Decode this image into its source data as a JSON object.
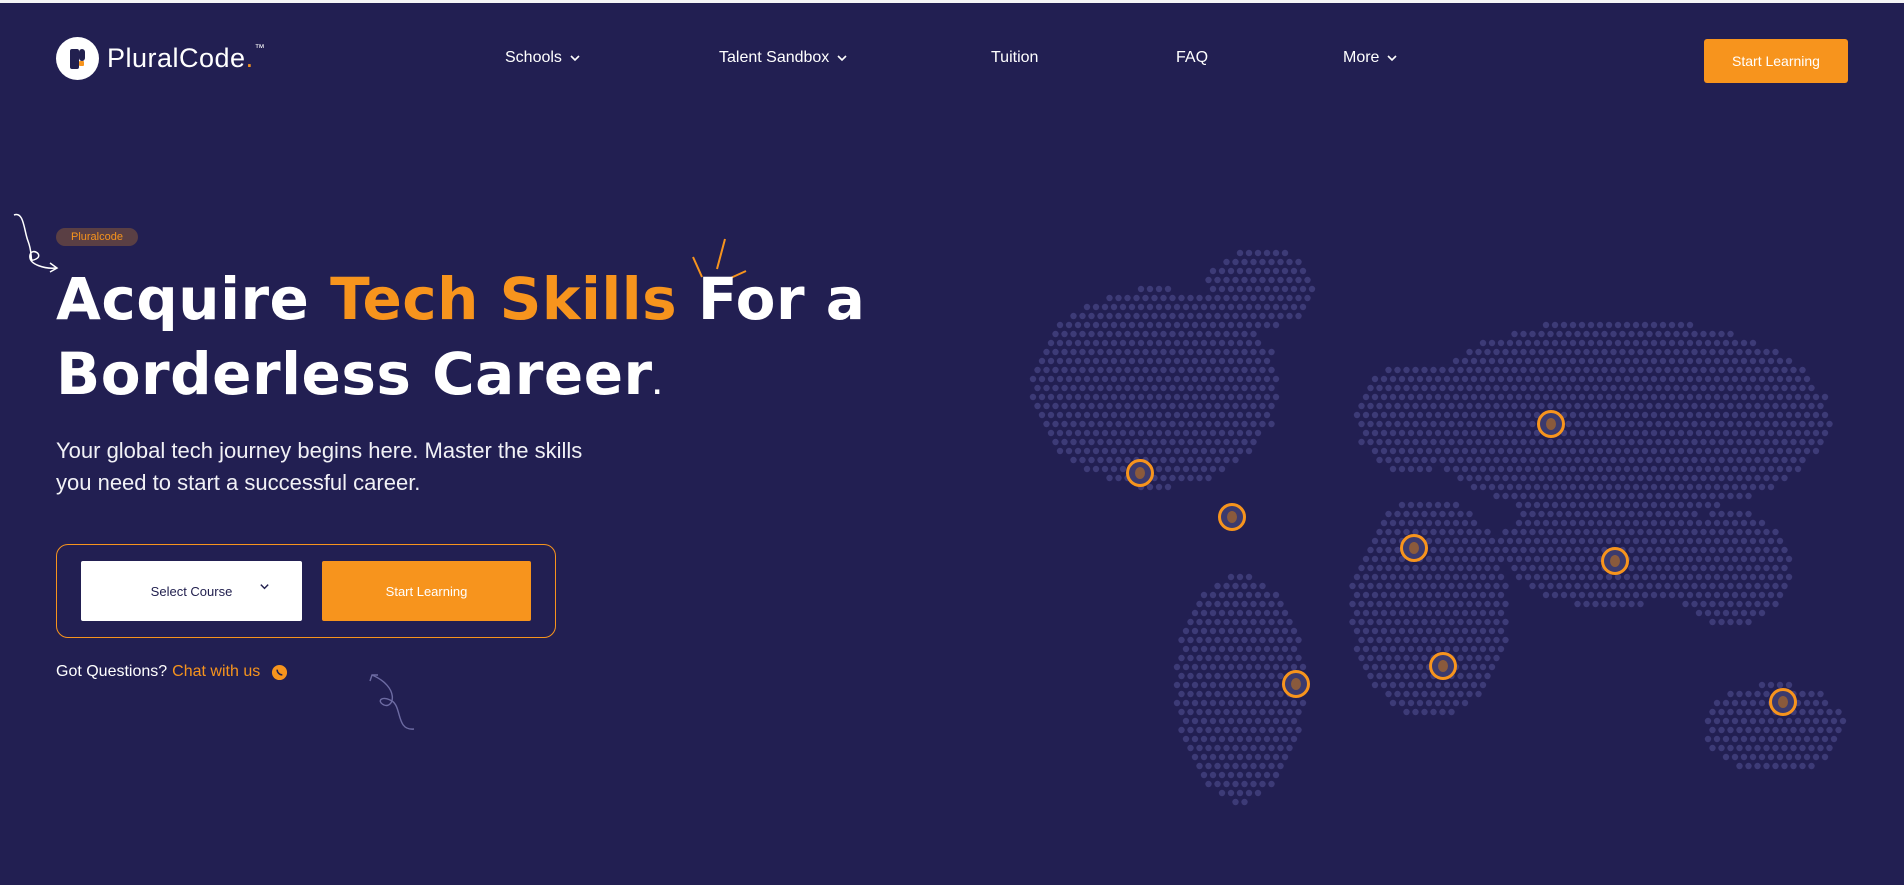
{
  "header": {
    "logo": {
      "name": "PluralCode",
      "dot": ".",
      "tm": "™"
    },
    "nav": [
      {
        "label": "Schools",
        "dropdown": true
      },
      {
        "label": "Talent Sandbox",
        "dropdown": true
      },
      {
        "label": "Tuition",
        "dropdown": false
      },
      {
        "label": "FAQ",
        "dropdown": false
      },
      {
        "label": "More",
        "dropdown": true
      }
    ],
    "cta_label": "Start Learning"
  },
  "hero": {
    "badge": "Pluralcode",
    "headline": {
      "part1": "Acquire ",
      "accent": "Tech Skills",
      "part2": " For a",
      "line2": "Borderless Career",
      "period": "."
    },
    "subtext": "Your global tech journey begins here. Master the skills you need to start a successful career.",
    "form": {
      "select_label": "Select Course",
      "button_label": "Start Learning"
    },
    "questions": {
      "label": "Got Questions?",
      "link": "Chat with us"
    }
  },
  "colors": {
    "background": "#221f52",
    "accent": "#f7941d",
    "map_dots": "#3d3b77",
    "badge_bg": "#5a3f44"
  },
  "icons": [
    "chevron-down-icon",
    "whatsapp-icon",
    "world-map",
    "logo-mark-icon"
  ]
}
